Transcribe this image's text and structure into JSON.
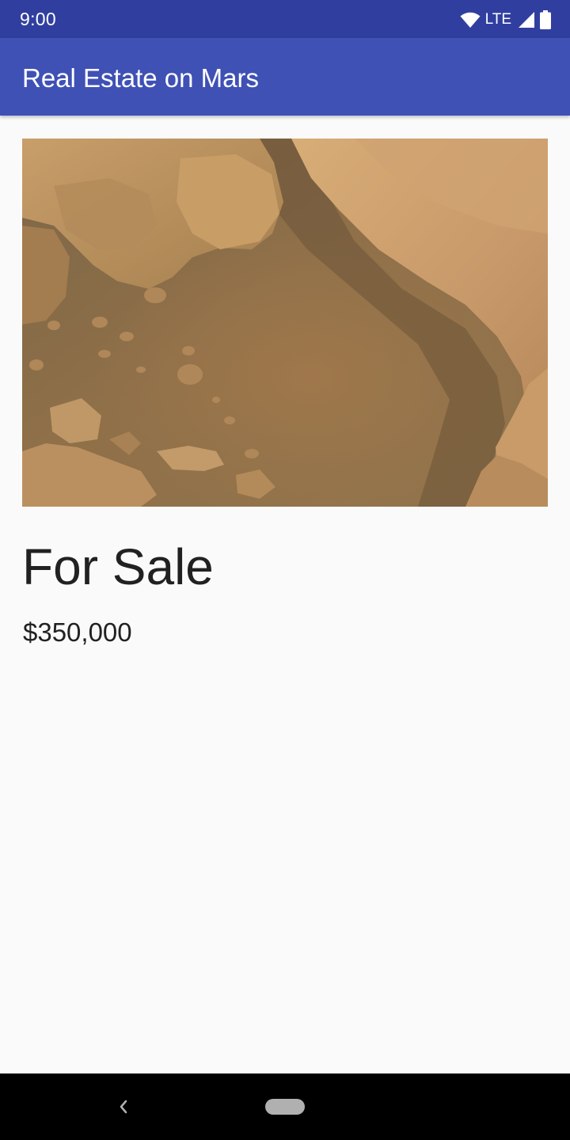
{
  "status_bar": {
    "time": "9:00",
    "network_label": "LTE",
    "icons": [
      "wifi-icon",
      "cell-signal-icon",
      "battery-icon"
    ]
  },
  "app_bar": {
    "title": "Real Estate on Mars"
  },
  "property": {
    "photo": "mars-terrain-photo",
    "type": "For Sale",
    "price": "$350,000"
  },
  "nav_bar": {
    "icons": [
      "back-icon",
      "home-pill-icon"
    ]
  },
  "colors": {
    "status_bar": "#303f9f",
    "app_bar": "#3f51b5",
    "background": "#fafafa",
    "text_primary": "#212121",
    "nav_bar": "#000000"
  }
}
